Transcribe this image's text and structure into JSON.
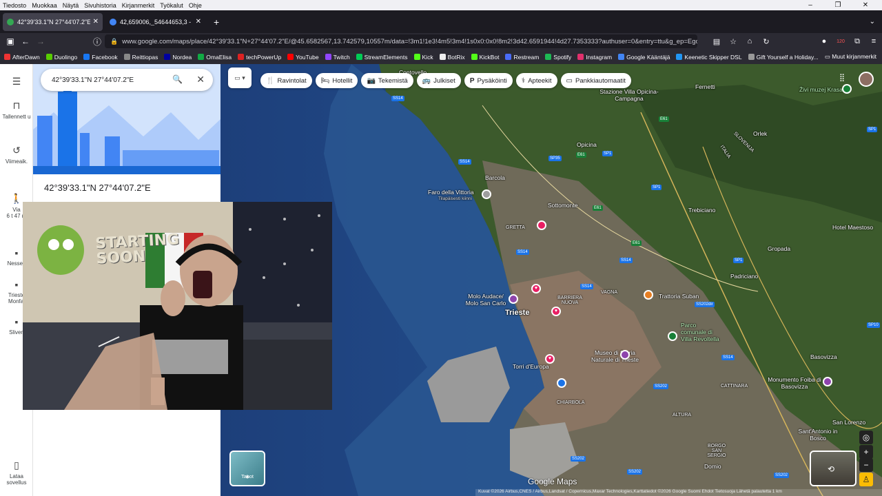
{
  "menubar": {
    "items": [
      "Tiedosto",
      "Muokkaa",
      "Näytä",
      "Sivuhistoria",
      "Kirjanmerkit",
      "Työkalut",
      "Ohje"
    ]
  },
  "tabs": [
    {
      "title": "42°39'33.1\"N 27°44'07.2\"E – Go",
      "active": true,
      "favicon_color": "#34a853"
    },
    {
      "title": "42,659006,_54644653,3 - Googl",
      "active": false,
      "favicon_color": "#4285f4"
    }
  ],
  "url": "www.google.com/maps/place/42°39'33.1\"N+27°44'07.2\"E/@45.6582567,13.742579,10557m/data=!3m1!1e3!4m5!3m4!1s0x0:0x0!8m2!3d42.6591944!4d27.7353333?authuser=0&entry=ttu&g_ep=EgoyMDI2M",
  "badge_count": "120",
  "bookmarks": [
    {
      "label": "AfterDawn",
      "color": "#e33"
    },
    {
      "label": "Duolingo",
      "color": "#58cc02"
    },
    {
      "label": "Facebook",
      "color": "#1877f2"
    },
    {
      "label": "Reittiopas",
      "color": "#888"
    },
    {
      "label": "Nordea",
      "color": "#0000a0"
    },
    {
      "label": "OmaElisa",
      "color": "#1a4"
    },
    {
      "label": "techPowerUp",
      "color": "#d22"
    },
    {
      "label": "YouTube",
      "color": "#f00"
    },
    {
      "label": "Twitch",
      "color": "#9146ff"
    },
    {
      "label": "StreamElements",
      "color": "#0c5"
    },
    {
      "label": "Kick",
      "color": "#53fc18"
    },
    {
      "label": "BotRix",
      "color": "#eee"
    },
    {
      "label": "KickBot",
      "color": "#53fc18"
    },
    {
      "label": "Restream",
      "color": "#4a6cf7"
    },
    {
      "label": "Spotify",
      "color": "#1db954"
    },
    {
      "label": "Instagram",
      "color": "#e1306c"
    },
    {
      "label": "Google Kääntäjä",
      "color": "#4285f4"
    },
    {
      "label": "Keenetic Skipper DSL",
      "color": "#2196f3"
    },
    {
      "label": "Gift Yourself a Holiday...",
      "color": "#999"
    }
  ],
  "bookmarks_other": "Muut kirjanmerkit",
  "rail": {
    "saved": "Tallennett u",
    "recent": "Viimeaik.",
    "via": "Via",
    "via_time": "6 t 47 m",
    "nessebar": "Nesseb",
    "trieste": "Trieste Monfal",
    "slovenia": "Sliven",
    "download": "Lataa sovellus"
  },
  "search": {
    "value": "42°39'33.1\"N 27°44'07.2\"E"
  },
  "place_title": "42°39'33.1\"N 27°44'07.2\"E",
  "chips": [
    {
      "label": "Ravintolat",
      "icon": "🍴"
    },
    {
      "label": "Hotellit",
      "icon": "🛏"
    },
    {
      "label": "Tekemistä",
      "icon": "📷"
    },
    {
      "label": "Julkiset",
      "icon": "🚌"
    },
    {
      "label": "Pysäköinti",
      "icon": "P"
    },
    {
      "label": "Apteekit",
      "icon": "⚕"
    },
    {
      "label": "Pankkiautomaatit",
      "icon": "▭"
    }
  ],
  "map_labels": {
    "trieste": "Trieste",
    "contovello": "Contovello",
    "opicina_campagna": "Stazione Villa Opicina-Campagna",
    "opicina": "Opicina",
    "barcola": "Barcola",
    "faro": "Faro della Vittoria",
    "faro_sub": "Tilapäisesti kiinni",
    "sottomonte": "Sottomonte",
    "gretta": "GRETTA",
    "molo": "Molo Audace/ Molo San Carlo",
    "barriera": "BARRIERA NUOVA",
    "museo": "Museo di Storia Naturale di Trieste",
    "torri": "Torri d'Europa",
    "chiarbola": "CHIARBOLA",
    "trattoria": "Trattoria Suban",
    "parco": "Parco comunale di Villa Revoltella",
    "trebiciano": "Trebiciano",
    "padriciano": "Padriciano",
    "gropada": "Gropada",
    "fernetti": "Fernetti",
    "orlek": "Orlek",
    "slovenija": "SLOVENIJA",
    "italia": "ITALIA",
    "zivi_muzej": "Živi muzej Krasa",
    "hotel_maestoso": "Hotel Maestoso",
    "basovizza": "Basovizza",
    "monumento": "Monumento Foiba di Basovizza",
    "san_lorenzo": "San Lorenzo",
    "santantonio": "Sant'Antonio in Bosco",
    "cattinara": "CATTINARA",
    "altura": "ALTURA",
    "borgo": "BORGO SAN SERGIO",
    "domio": "Domio",
    "vagna": "VAGNA"
  },
  "layers_label": "Tasot",
  "maps_brand": "Google Maps",
  "attribution": "Kuvat ©2026 Airbus,CNES / Airbus,Landsat / Copernicus,Maxar Technologies,Karttatiedot ©2026 Google   Suomi   Ehdot   Tietosuoja   Lähetä palautetta   1 km",
  "webcam_sign": "STARTING SOON"
}
